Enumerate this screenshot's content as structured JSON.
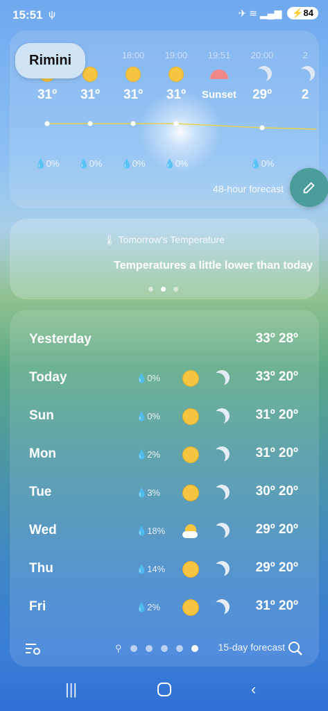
{
  "status": {
    "time": "15:51",
    "usb_glyph": "ψ",
    "signal": "✈ ≋ ▂▄▆",
    "battery": "84"
  },
  "location": {
    "city": "Rimini"
  },
  "hourly": {
    "items": [
      {
        "time": "",
        "icon": "sun",
        "temp": "31º",
        "precip": "0%"
      },
      {
        "time": "",
        "icon": "sun",
        "temp": "31º",
        "precip": "0%"
      },
      {
        "time": "18:00",
        "icon": "sun",
        "temp": "31º",
        "precip": "0%"
      },
      {
        "time": "19:00",
        "icon": "sun",
        "temp": "31º",
        "precip": "0%"
      },
      {
        "time": "19:51",
        "icon": "sunset",
        "temp": "Sunset",
        "precip": ""
      },
      {
        "time": "20:00",
        "icon": "moon",
        "temp": "29º",
        "precip": "0%"
      },
      {
        "time": "2",
        "icon": "moon",
        "temp": "2",
        "precip": ""
      }
    ],
    "forecast_label": "48-hour forecast"
  },
  "insight": {
    "title": "Tomorrow's Temperature",
    "text": "Temperatures a little lower than today",
    "page": 2,
    "page_count": 3
  },
  "daily": {
    "rows": [
      {
        "day": "Yesterday",
        "precip": "",
        "icon_day": "",
        "icon_night": "",
        "temps": "33º 28º"
      },
      {
        "day": "Today",
        "precip": "0%",
        "icon_day": "sun",
        "icon_night": "moon",
        "temps": "33º 20º"
      },
      {
        "day": "Sun",
        "precip": "0%",
        "icon_day": "sun",
        "icon_night": "moon",
        "temps": "31º 20º"
      },
      {
        "day": "Mon",
        "precip": "2%",
        "icon_day": "sun",
        "icon_night": "moon",
        "temps": "31º 20º"
      },
      {
        "day": "Tue",
        "precip": "3%",
        "icon_day": "sun",
        "icon_night": "moon-cloud",
        "temps": "30º 20º"
      },
      {
        "day": "Wed",
        "precip": "18%",
        "icon_day": "sun-cloud",
        "icon_night": "moon-cloud",
        "temps": "29º 20º"
      },
      {
        "day": "Thu",
        "precip": "14%",
        "icon_day": "sun",
        "icon_night": "moon",
        "temps": "29º 20º"
      },
      {
        "day": "Fri",
        "precip": "2%",
        "icon_day": "sun",
        "icon_night": "moon",
        "temps": "31º 20º"
      }
    ],
    "forecast_label": "15-day forecast",
    "page_current": 5,
    "page_count": 5
  },
  "colors": {
    "sun": "#f7c640",
    "sunset": "#f08a8a",
    "fab": "#4b9d9b",
    "temp_line": "#e7d24a"
  }
}
